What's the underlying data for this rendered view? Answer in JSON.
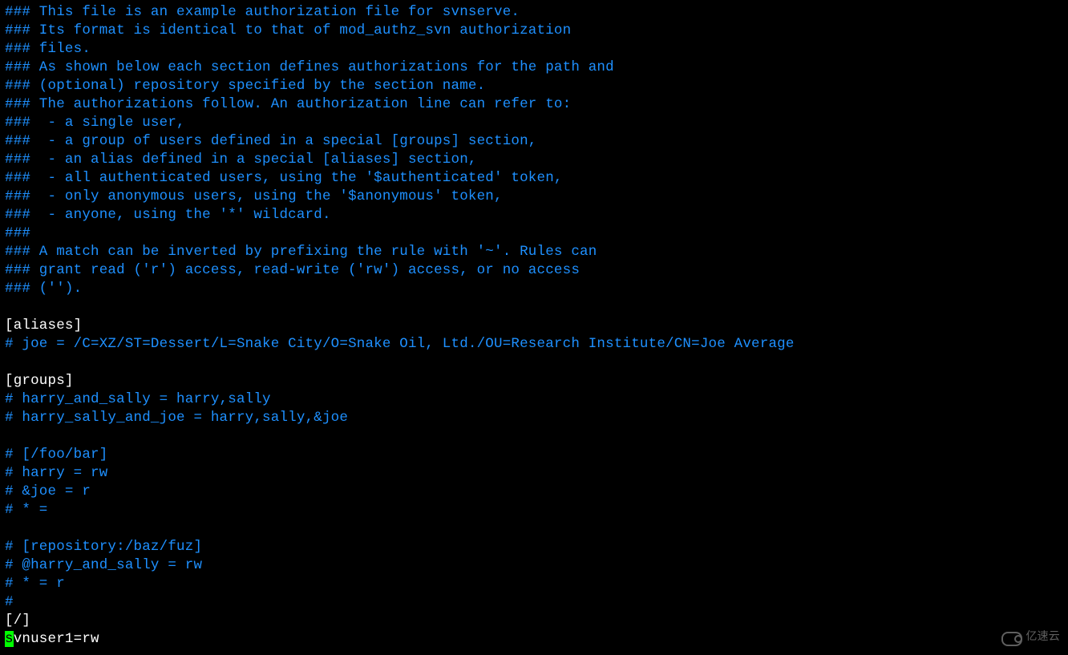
{
  "lines": [
    {
      "type": "comment",
      "text": "### This file is an example authorization file for svnserve."
    },
    {
      "type": "comment",
      "text": "### Its format is identical to that of mod_authz_svn authorization"
    },
    {
      "type": "comment",
      "text": "### files."
    },
    {
      "type": "comment",
      "text": "### As shown below each section defines authorizations for the path and"
    },
    {
      "type": "comment",
      "text": "### (optional) repository specified by the section name."
    },
    {
      "type": "comment",
      "text": "### The authorizations follow. An authorization line can refer to:"
    },
    {
      "type": "comment",
      "text": "###  - a single user,"
    },
    {
      "type": "comment",
      "text": "###  - a group of users defined in a special [groups] section,"
    },
    {
      "type": "comment",
      "text": "###  - an alias defined in a special [aliases] section,"
    },
    {
      "type": "comment",
      "text": "###  - all authenticated users, using the '$authenticated' token,"
    },
    {
      "type": "comment",
      "text": "###  - only anonymous users, using the '$anonymous' token,"
    },
    {
      "type": "comment",
      "text": "###  - anyone, using the '*' wildcard."
    },
    {
      "type": "comment",
      "text": "###"
    },
    {
      "type": "comment",
      "text": "### A match can be inverted by prefixing the rule with '~'. Rules can"
    },
    {
      "type": "comment",
      "text": "### grant read ('r') access, read-write ('rw') access, or no access"
    },
    {
      "type": "comment",
      "text": "### ('')."
    },
    {
      "type": "blank",
      "text": ""
    },
    {
      "type": "section",
      "text": "[aliases]"
    },
    {
      "type": "comment",
      "text": "# joe = /C=XZ/ST=Dessert/L=Snake City/O=Snake Oil, Ltd./OU=Research Institute/CN=Joe Average"
    },
    {
      "type": "blank",
      "text": ""
    },
    {
      "type": "section",
      "text": "[groups]"
    },
    {
      "type": "comment",
      "text": "# harry_and_sally = harry,sally"
    },
    {
      "type": "comment",
      "text": "# harry_sally_and_joe = harry,sally,&joe"
    },
    {
      "type": "blank",
      "text": ""
    },
    {
      "type": "comment",
      "text": "# [/foo/bar]"
    },
    {
      "type": "comment",
      "text": "# harry = rw"
    },
    {
      "type": "comment",
      "text": "# &joe = r"
    },
    {
      "type": "comment",
      "text": "# * ="
    },
    {
      "type": "blank",
      "text": ""
    },
    {
      "type": "comment",
      "text": "# [repository:/baz/fuz]"
    },
    {
      "type": "comment",
      "text": "# @harry_and_sally = rw"
    },
    {
      "type": "comment",
      "text": "# * = r"
    },
    {
      "type": "comment",
      "text": "#"
    },
    {
      "type": "section",
      "text": "[/]"
    },
    {
      "type": "cursor",
      "cursor_char": "s",
      "rest": "vnuser1=rw"
    }
  ],
  "watermark": {
    "text": "亿速云"
  }
}
